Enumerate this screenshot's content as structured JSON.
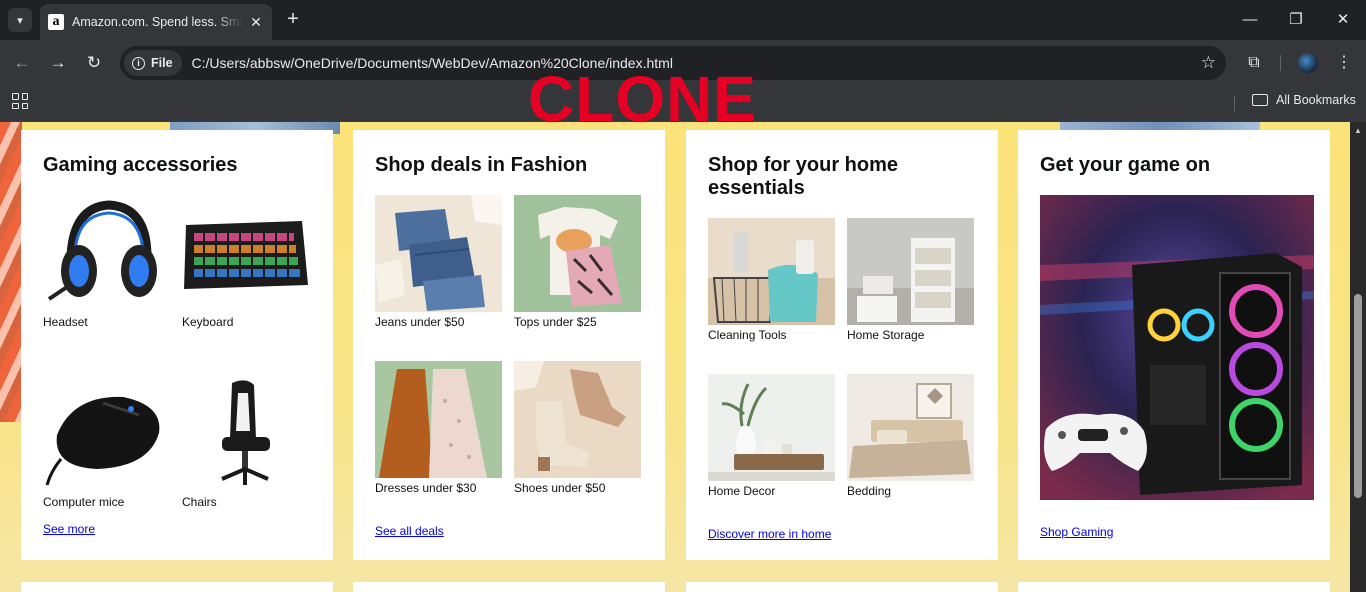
{
  "browser": {
    "tab_title": "Amazon.com. Spend less. Smile more.",
    "favicon_letter": "a",
    "file_chip": "File",
    "url": "C:/Users/abbsw/OneDrive/Documents/WebDev/Amazon%20Clone/index.html",
    "bookmarks_label": "All Bookmarks",
    "icons": {
      "tab_search": "▾",
      "tab_close": "✕",
      "new_tab": "+",
      "minimize": "—",
      "restore": "❐",
      "close": "✕",
      "back": "←",
      "forward": "→",
      "reload": "↻",
      "info": "i",
      "star": "☆",
      "extensions": "⧉",
      "menu": "⋮"
    }
  },
  "overlay": {
    "text": "CLONE",
    "color": "#e60023"
  },
  "cards": [
    {
      "title": "Gaming accessories",
      "items": [
        {
          "label": "Headset"
        },
        {
          "label": "Keyboard"
        },
        {
          "label": "Computer mice"
        },
        {
          "label": "Chairs"
        }
      ],
      "link": "See more"
    },
    {
      "title": "Shop deals in Fashion",
      "items": [
        {
          "label": "Jeans under $50"
        },
        {
          "label": "Tops under $25"
        },
        {
          "label": "Dresses under $30"
        },
        {
          "label": "Shoes under $50"
        }
      ],
      "link": "See all deals"
    },
    {
      "title": "Shop for your home essentials",
      "items": [
        {
          "label": "Cleaning Tools"
        },
        {
          "label": "Home Storage"
        },
        {
          "label": "Home Decor"
        },
        {
          "label": "Bedding"
        }
      ],
      "link": "Discover more in home"
    },
    {
      "title": "Get your game on",
      "link": "Shop Gaming"
    }
  ],
  "colors": {
    "link": "#0000ee",
    "page_bg": "#fbe27a",
    "chrome_dark": "#202124",
    "chrome": "#35363a"
  }
}
